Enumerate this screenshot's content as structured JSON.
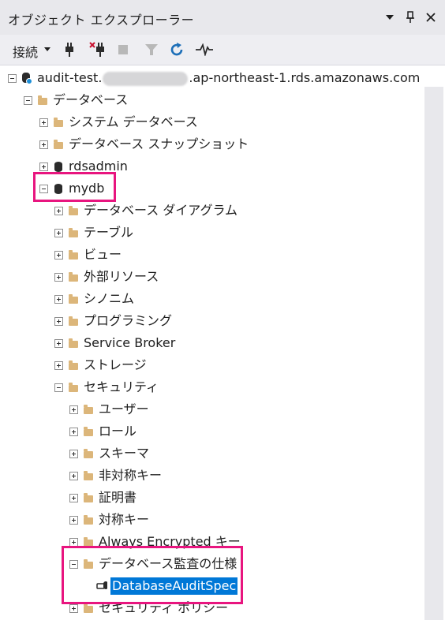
{
  "panel": {
    "title": "オブジェクト エクスプローラー"
  },
  "toolbar": {
    "connect_label": "接続"
  },
  "tree": {
    "server_prefix": "audit-test.",
    "server_suffix": ".ap-northeast-1.rds.amazonaws.com",
    "databases": "データベース",
    "system_databases": "システム データベース",
    "snapshots": "データベース スナップショット",
    "rdsadmin": "rdsadmin",
    "mydb": "mydb",
    "diagrams": "データベース ダイアグラム",
    "tables": "テーブル",
    "views": "ビュー",
    "external": "外部リソース",
    "synonyms": "シノニム",
    "programmability": "プログラミング",
    "service_broker": "Service Broker",
    "storage": "ストレージ",
    "security": "セキュリティ",
    "users": "ユーザー",
    "roles": "ロール",
    "schemas": "スキーマ",
    "asym_keys": "非対称キー",
    "certificates": "証明書",
    "sym_keys": "対称キー",
    "always_encrypted": "Always Encrypted キー",
    "audit_specs": "データベース監査の仕様",
    "audit_spec_item": "DatabaseAuditSpec",
    "security_policies": "セキュリティ ポリシー"
  },
  "colors": {
    "selection": "#0078d7",
    "highlight": "#e8157f",
    "folder": "#dcb67a"
  }
}
